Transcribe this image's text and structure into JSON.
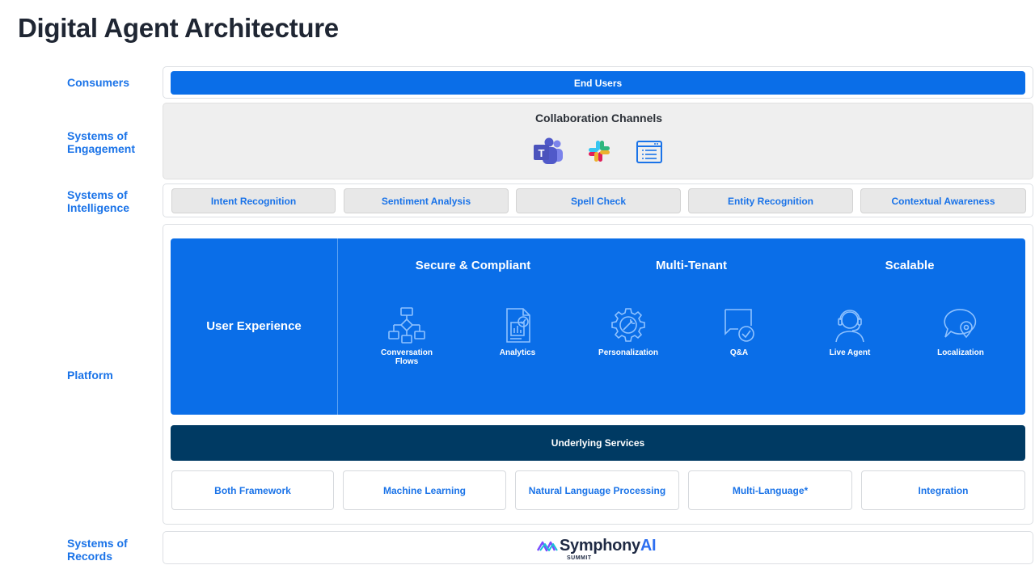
{
  "title": "Digital Agent Architecture",
  "layers": {
    "consumers": "Consumers",
    "engagement": "Systems of\nEngagement",
    "intelligence": "Systems of\nIntelligence",
    "platform": "Platform",
    "records": "Systems of\nRecords"
  },
  "consumers_bar": "End Users",
  "collaboration": {
    "title": "Collaboration Channels",
    "icons": [
      "teams-icon",
      "slack-icon",
      "web-chat-icon"
    ]
  },
  "intelligence_items": [
    "Intent Recognition",
    "Sentiment Analysis",
    "Spell Check",
    "Entity Recognition",
    "Contextual Awareness"
  ],
  "platform": {
    "user_experience": "User Experience",
    "headings": [
      "Secure & Compliant",
      "Multi-Tenant",
      "Scalable"
    ],
    "features": [
      {
        "label": "Conversation\nFlows",
        "icon": "flowchart-icon"
      },
      {
        "label": "Analytics",
        "icon": "analytics-report-icon"
      },
      {
        "label": "Personalization",
        "icon": "gear-wrench-icon"
      },
      {
        "label": "Q&A",
        "icon": "chat-check-icon"
      },
      {
        "label": "Live Agent",
        "icon": "headset-agent-icon"
      },
      {
        "label": "Localization",
        "icon": "location-chat-icon"
      }
    ],
    "underlying_services": "Underlying Services",
    "services": [
      "Both Framework",
      "Machine Learning",
      "Natural Language Processing",
      "Multi-Language*",
      "Integration"
    ]
  },
  "records": {
    "brand_main": "Symphony",
    "brand_ai": "AI",
    "brand_sub": "SUMMIT"
  },
  "colors": {
    "primary_blue": "#0a6ee8",
    "navy": "#003a63",
    "label_blue": "#1a73e8"
  }
}
